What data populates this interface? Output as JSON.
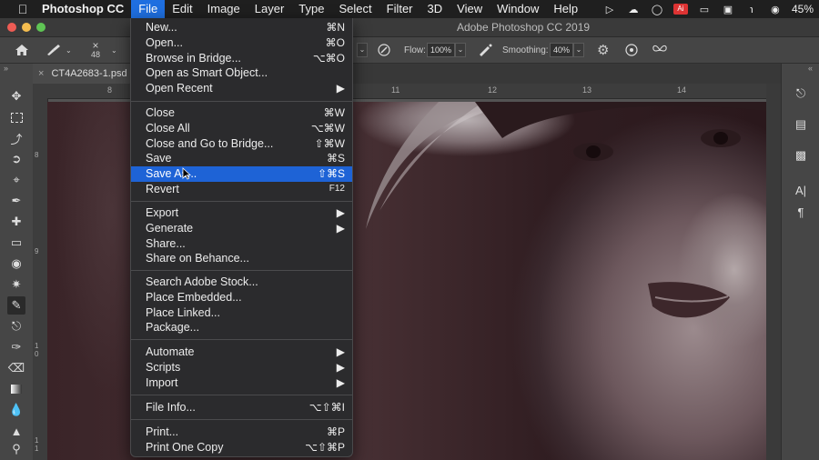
{
  "menubar": {
    "app_name": "Photoshop CC",
    "items": [
      "File",
      "Edit",
      "Image",
      "Layer",
      "Type",
      "Select",
      "Filter",
      "3D",
      "View",
      "Window",
      "Help"
    ],
    "active": "File",
    "battery": "45%"
  },
  "window": {
    "title": "Adobe Photoshop CC 2019"
  },
  "options": {
    "brush_size": "48",
    "flow_label": "Flow:",
    "flow_value": "100%",
    "smoothing_label": "Smoothing:",
    "smoothing_value": "40%"
  },
  "document": {
    "tab_name": "CT4A2683-1.psd"
  },
  "rulers": {
    "h_labels": [
      "8",
      "11",
      "12",
      "13",
      "14"
    ],
    "v_labels": [
      "8",
      "9",
      "1\n0",
      "1\n1"
    ]
  },
  "file_menu": {
    "items": [
      {
        "label": "New...",
        "shortcut": "⌘N"
      },
      {
        "label": "Open...",
        "shortcut": "⌘O"
      },
      {
        "label": "Browse in Bridge...",
        "shortcut": "⌥⌘O"
      },
      {
        "label": "Open as Smart Object...",
        "shortcut": ""
      },
      {
        "label": "Open Recent",
        "shortcut": "▶"
      },
      {
        "label": "Close",
        "shortcut": "⌘W"
      },
      {
        "label": "Close All",
        "shortcut": "⌥⌘W"
      },
      {
        "label": "Close and Go to Bridge...",
        "shortcut": "⇧⌘W"
      },
      {
        "label": "Save",
        "shortcut": "⌘S"
      },
      {
        "label": "Save As...",
        "shortcut": "⇧⌘S"
      },
      {
        "label": "Revert",
        "shortcut": "F12"
      },
      {
        "label": "Export",
        "shortcut": "▶"
      },
      {
        "label": "Generate",
        "shortcut": "▶"
      },
      {
        "label": "Share...",
        "shortcut": ""
      },
      {
        "label": "Share on Behance...",
        "shortcut": ""
      },
      {
        "label": "Search Adobe Stock...",
        "shortcut": ""
      },
      {
        "label": "Place Embedded...",
        "shortcut": ""
      },
      {
        "label": "Place Linked...",
        "shortcut": ""
      },
      {
        "label": "Package...",
        "shortcut": ""
      },
      {
        "label": "Automate",
        "shortcut": "▶"
      },
      {
        "label": "Scripts",
        "shortcut": "▶"
      },
      {
        "label": "Import",
        "shortcut": "▶"
      },
      {
        "label": "File Info...",
        "shortcut": "⌥⇧⌘I"
      },
      {
        "label": "Print...",
        "shortcut": "⌘P"
      },
      {
        "label": "Print One Copy",
        "shortcut": "⌥⇧⌘P"
      }
    ],
    "highlighted": "Save As..."
  },
  "colors": {
    "menu_highlight": "#1e63d6",
    "menubar_active": "#1f6fe0",
    "panel": "#464646"
  }
}
